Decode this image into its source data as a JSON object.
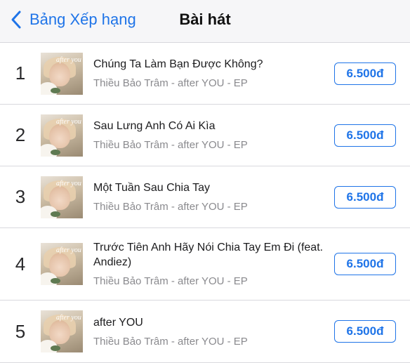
{
  "navbar": {
    "back_label": "Bảng Xếp hạng",
    "title": "Bài hát"
  },
  "songs": [
    {
      "rank": "1",
      "title": "Chúng Ta Làm Bạn Được Không?",
      "subtitle": "Thiều Bảo Trâm - after YOU - EP",
      "price": "6.500đ"
    },
    {
      "rank": "2",
      "title": "Sau Lưng Anh Có Ai Kìa",
      "subtitle": "Thiều Bảo Trâm - after YOU - EP",
      "price": "6.500đ"
    },
    {
      "rank": "3",
      "title": "Một Tuần Sau Chia Tay",
      "subtitle": "Thiều Bảo Trâm - after YOU - EP",
      "price": "6.500đ"
    },
    {
      "rank": "4",
      "title": "Trước Tiên Anh Hãy Nói Chia Tay Em Đi (feat. Andiez)",
      "subtitle": "Thiều Bảo Trâm - after YOU - EP",
      "price": "6.500đ"
    },
    {
      "rank": "5",
      "title": "after YOU",
      "subtitle": "Thiều Bảo Trâm - after YOU - EP",
      "price": "6.500đ"
    }
  ],
  "artwork": {
    "logo_text": "after you"
  },
  "colors": {
    "accent": "#1f74e8",
    "secondary_text": "#8a8a8e",
    "navbar_bg": "#f6f6f8"
  }
}
